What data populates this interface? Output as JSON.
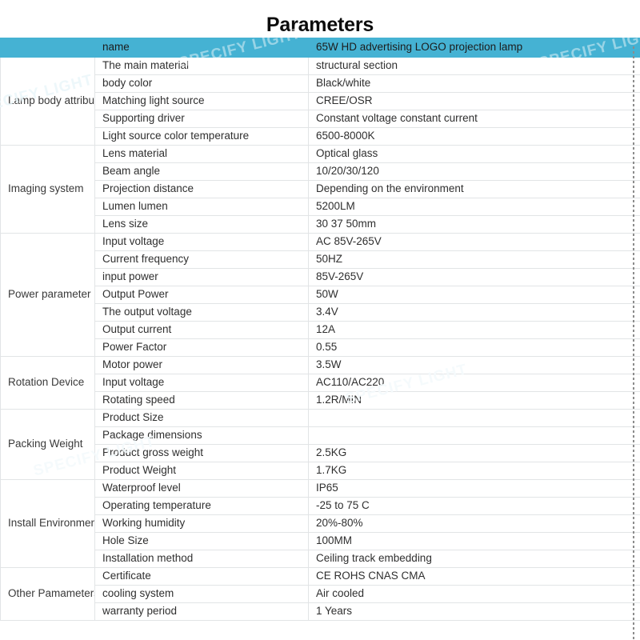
{
  "page": {
    "title": "Parameters"
  },
  "watermarks": {
    "text": "SPECIFY LIGHT",
    "color": "#ffffff",
    "instances": [
      "SPECIFY LIGHT",
      "SPECIFY LIGHT",
      "SPECIFY LIGHT",
      "SPECIFY LIGHT",
      "SPECIFY LIGHT"
    ]
  },
  "theme": {
    "header_bg": "#45b2d3",
    "grid_line": "#e2e4e6",
    "text": "#2f2f2f",
    "page_bg": "#ffffff"
  },
  "table": {
    "columns": [
      "group",
      "name",
      "value"
    ],
    "header": {
      "group": "",
      "name": "name",
      "value": "65W HD advertising LOGO projection lamp"
    },
    "groups": [
      {
        "label": "Lamp body attribute",
        "rows": [
          {
            "name": "The main material",
            "value": "structural section"
          },
          {
            "name": "body color",
            "value": "Black/white"
          },
          {
            "name": "Matching light source",
            "value": "CREE/OSR"
          },
          {
            "name": "Supporting driver",
            "value": "Constant voltage constant current"
          },
          {
            "name": "Light source color temperature",
            "value": "6500-8000K"
          }
        ]
      },
      {
        "label": "Imaging system",
        "rows": [
          {
            "name": "Lens material",
            "value": "Optical glass"
          },
          {
            "name": "Beam angle",
            "value": "10/20/30/120"
          },
          {
            "name": "Projection distance",
            "value": "Depending on the environment"
          },
          {
            "name": "Lumen lumen",
            "value": "5200LM"
          },
          {
            "name": "Lens size",
            "value": "30 37 50mm"
          }
        ]
      },
      {
        "label": "Power parameter",
        "rows": [
          {
            "name": "Input voltage",
            "value": "AC 85V-265V"
          },
          {
            "name": "Current frequency",
            "value": "50HZ"
          },
          {
            "name": "input power",
            "value": "85V-265V"
          },
          {
            "name": "Output Power",
            "value": "50W"
          },
          {
            "name": "The output voltage",
            "value": "3.4V"
          },
          {
            "name": "Output current",
            "value": "12A"
          },
          {
            "name": "Power Factor",
            "value": "0.55"
          }
        ]
      },
      {
        "label": "Rotation Device",
        "rows": [
          {
            "name": "Motor power",
            "value": "3.5W"
          },
          {
            "name": "Input voltage",
            "value": "AC110/AC220"
          },
          {
            "name": "Rotating speed",
            "value": "1.2R/MIN"
          }
        ]
      },
      {
        "label": "Packing Weight",
        "rows": [
          {
            "name": "Product Size",
            "value": ""
          },
          {
            "name": "Package dimensions",
            "value": ""
          },
          {
            "name": "Product gross weight",
            "value": "2.5KG"
          },
          {
            "name": "Product Weight",
            "value": "1.7KG"
          }
        ]
      },
      {
        "label": "Install Environment",
        "rows": [
          {
            "name": "Waterproof level",
            "value": "IP65"
          },
          {
            "name": "Operating temperature",
            "value": "-25 to 75 C"
          },
          {
            "name": "Working humidity",
            "value": "20%-80%"
          },
          {
            "name": "Hole Size",
            "value": "100MM"
          },
          {
            "name": "Installation method",
            "value": "Ceiling track embedding"
          }
        ]
      },
      {
        "label": "Other Pamameters",
        "rows": [
          {
            "name": "Certificate",
            "value": "CE ROHS CNAS CMA"
          },
          {
            "name": "cooling system",
            "value": "Air cooled"
          },
          {
            "name": "warranty period",
            "value": "1 Years"
          }
        ]
      }
    ]
  }
}
